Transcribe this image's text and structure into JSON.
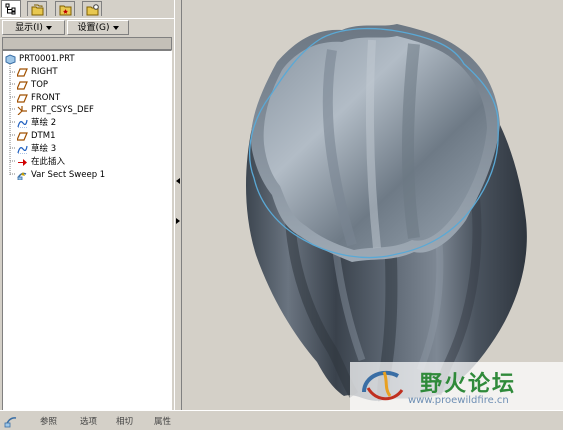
{
  "tabs": [
    {
      "icon": "model-tree-icon"
    },
    {
      "icon": "folder-browser-icon"
    },
    {
      "icon": "favorites-icon"
    },
    {
      "icon": "connections-icon"
    }
  ],
  "menu": {
    "show_label": "显示(I)",
    "settings_label": "设置(G)"
  },
  "tree": {
    "root": "PRT0001.PRT",
    "items": [
      {
        "label": "RIGHT",
        "icon": "datum-plane-icon"
      },
      {
        "label": "TOP",
        "icon": "datum-plane-icon"
      },
      {
        "label": "FRONT",
        "icon": "datum-plane-icon"
      },
      {
        "label": "PRT_CSYS_DEF",
        "icon": "csys-icon"
      },
      {
        "label": "草绘 2",
        "icon": "sketch-icon"
      },
      {
        "label": "DTM1",
        "icon": "datum-plane-icon"
      },
      {
        "label": "草绘 3",
        "icon": "sketch-icon"
      },
      {
        "label": "在此插入",
        "icon": "insert-here-arrow-icon"
      },
      {
        "label": "Var Sect Sweep 1",
        "icon": "sweep-feature-icon"
      }
    ]
  },
  "watermark": {
    "title": "野火论坛",
    "url": "www.proewildfire.cn"
  },
  "bottom_tabs": [
    "参照",
    "选项",
    "相切",
    "属性"
  ],
  "colors": {
    "panel_bg": "#d4d0c8",
    "tree_bg": "#ffffff",
    "surface": "#5a6470",
    "sketch_curve": "#5aa9d6",
    "watermark_green": "#2f8a3a"
  }
}
